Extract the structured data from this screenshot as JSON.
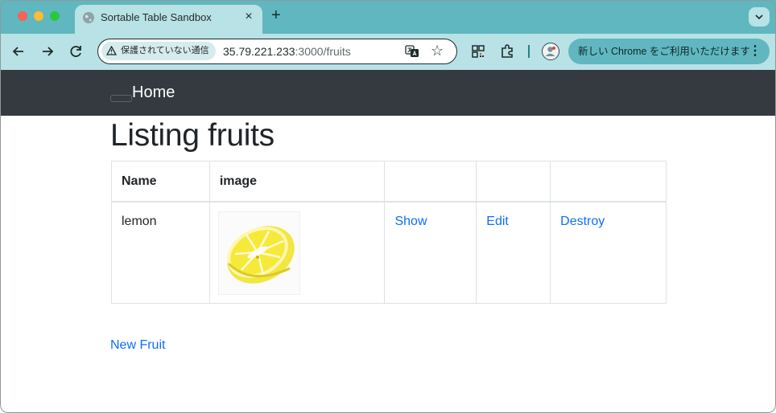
{
  "browser": {
    "tab_title": "Sortable Table Sandbox",
    "tab_close_glyph": "×",
    "new_tab_glyph": "+",
    "security_label": "保護されていない通信",
    "url_host": "35.79.221.233",
    "url_path": ":3000/fruits",
    "star_glyph": "☆",
    "promo_label": "新しい Chrome をご利用いただけます",
    "promo_menu_glyph": "⋮",
    "icons": [
      "back-arrow-icon",
      "forward-arrow-icon",
      "reload-icon",
      "warning-icon",
      "translate-icon",
      "star-icon",
      "qr-code-icon",
      "extensions-icon",
      "profile-icon"
    ],
    "colors": {
      "tabstrip": "#60b7bf",
      "toolbar": "#b8e2e5"
    }
  },
  "navbar": {
    "home_label": "Home",
    "background": "#343a40"
  },
  "page": {
    "title": "Listing fruits",
    "new_link": "New Fruit"
  },
  "table": {
    "headers": {
      "name": "Name",
      "image": "image"
    },
    "rows": [
      {
        "name": "lemon",
        "image_alt": "lemon",
        "show": "Show",
        "edit": "Edit",
        "destroy": "Destroy"
      }
    ]
  },
  "colors": {
    "link": "#0d6efd",
    "text": "#212529"
  }
}
